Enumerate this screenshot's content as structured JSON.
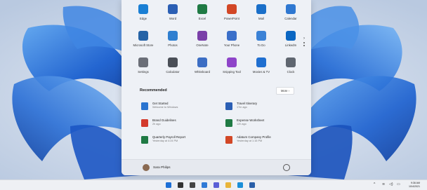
{
  "pinned_apps": [
    {
      "label": "Edge",
      "color": "#1a7fd4"
    },
    {
      "label": "Word",
      "color": "#2b5fb4"
    },
    {
      "label": "Excel",
      "color": "#1f7a44"
    },
    {
      "label": "PowerPoint",
      "color": "#d24726"
    },
    {
      "label": "Mail",
      "color": "#1a6fc9"
    },
    {
      "label": "Calendar",
      "color": "#2f78d1"
    },
    {
      "label": "Microsoft Store",
      "color": "#2563a6"
    },
    {
      "label": "Photos",
      "color": "#2f7fd0"
    },
    {
      "label": "OneNote",
      "color": "#7a3fa8"
    },
    {
      "label": "Your Phone",
      "color": "#3a6fc9"
    },
    {
      "label": "To Do",
      "color": "#3b82d6"
    },
    {
      "label": "LinkedIn",
      "color": "#0a66c2"
    },
    {
      "label": "Settings",
      "color": "#6b6f78"
    },
    {
      "label": "Calculator",
      "color": "#4a4f57"
    },
    {
      "label": "Whiteboard",
      "color": "#3c6ec4"
    },
    {
      "label": "Snipping Tool",
      "color": "#8e44c9"
    },
    {
      "label": "Movies & TV",
      "color": "#1f6fd0"
    },
    {
      "label": "Clock",
      "color": "#5f6670"
    }
  ],
  "recommended": {
    "title": "Recommended",
    "more_label": "More  ›",
    "items": [
      {
        "name": "Get Started",
        "detail": "Welcome to Windows",
        "color": "#2a74d0"
      },
      {
        "name": "Travel Itinerary",
        "detail": "17m ago",
        "color": "#2b5fb4"
      },
      {
        "name": "Brand Guidelines",
        "detail": "2h ago",
        "color": "#d33a2c"
      },
      {
        "name": "Expense Worksheet",
        "detail": "12h ago",
        "color": "#1f7a44"
      },
      {
        "name": "Quarterly Payroll Report",
        "detail": "Yesterday at 4:24 PM",
        "color": "#1f7a44"
      },
      {
        "name": "Adatum Company Profile",
        "detail": "Yesterday at 1:15 PM",
        "color": "#d24726"
      }
    ]
  },
  "user": {
    "name": "Sara Philips"
  },
  "taskbar": {
    "icons": [
      {
        "name": "start-icon",
        "color": "#1d6fd6"
      },
      {
        "name": "search-icon",
        "color": "#333333"
      },
      {
        "name": "task-view-icon",
        "color": "#444444"
      },
      {
        "name": "widgets-icon",
        "color": "#2f7ad6"
      },
      {
        "name": "chat-icon",
        "color": "#5a5fd6"
      },
      {
        "name": "file-explorer-icon",
        "color": "#e8b43a"
      },
      {
        "name": "edge-icon",
        "color": "#1a8fd8"
      },
      {
        "name": "store-icon",
        "color": "#2a5fa8"
      }
    ],
    "time": "9:38 AM",
    "date": "10/4/2021"
  }
}
